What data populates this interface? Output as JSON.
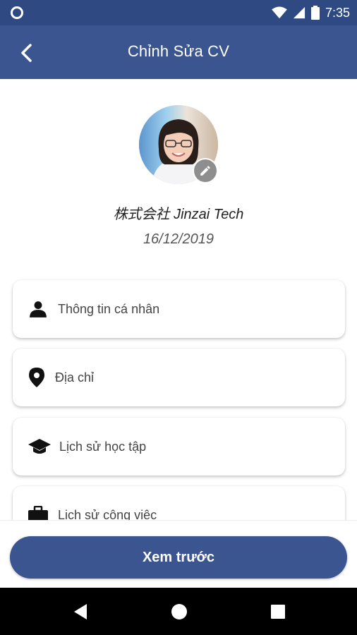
{
  "status_bar": {
    "time": "7:35"
  },
  "app_bar": {
    "title": "Chỉnh Sửa CV"
  },
  "profile": {
    "company": "株式会社 Jinzai Tech",
    "date": "16/12/2019"
  },
  "sections": [
    {
      "label": "Thông tin cá nhân",
      "icon": "person-icon"
    },
    {
      "label": "Địa chỉ",
      "icon": "location-pin-icon"
    },
    {
      "label": "Lịch sử học tập",
      "icon": "graduation-cap-icon"
    },
    {
      "label": "Lịch sử công việc",
      "icon": "briefcase-icon"
    }
  ],
  "actions": {
    "preview_label": "Xem trước"
  },
  "colors": {
    "primary": "#3b5591",
    "status_bar": "#2f4a82"
  }
}
